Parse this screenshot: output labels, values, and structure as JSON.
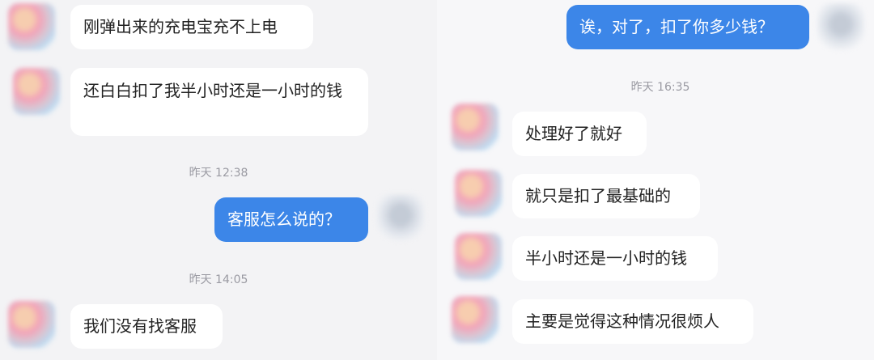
{
  "left": {
    "messages": [
      {
        "text": "刚弹出来的充电宝充不上电"
      },
      {
        "text": "还白白扣了我半小时还是一小时的钱"
      },
      {
        "text": "客服怎么说的？"
      },
      {
        "text": "我们没有找客服"
      }
    ],
    "timestamps": [
      "昨天 12:38",
      "昨天 14:05"
    ]
  },
  "right": {
    "messages": [
      {
        "text": "诶，对了，扣了你多少钱？"
      },
      {
        "text": "处理好了就好"
      },
      {
        "text": "就只是扣了最基础的"
      },
      {
        "text": "半小时还是一小时的钱"
      },
      {
        "text": "主要是觉得这种情况很烦人"
      }
    ],
    "timestamps": [
      "昨天 16:35"
    ]
  },
  "colors": {
    "sent_bubble": "#3c86e8",
    "received_bubble": "#ffffff",
    "background": "#f3f3f5"
  }
}
